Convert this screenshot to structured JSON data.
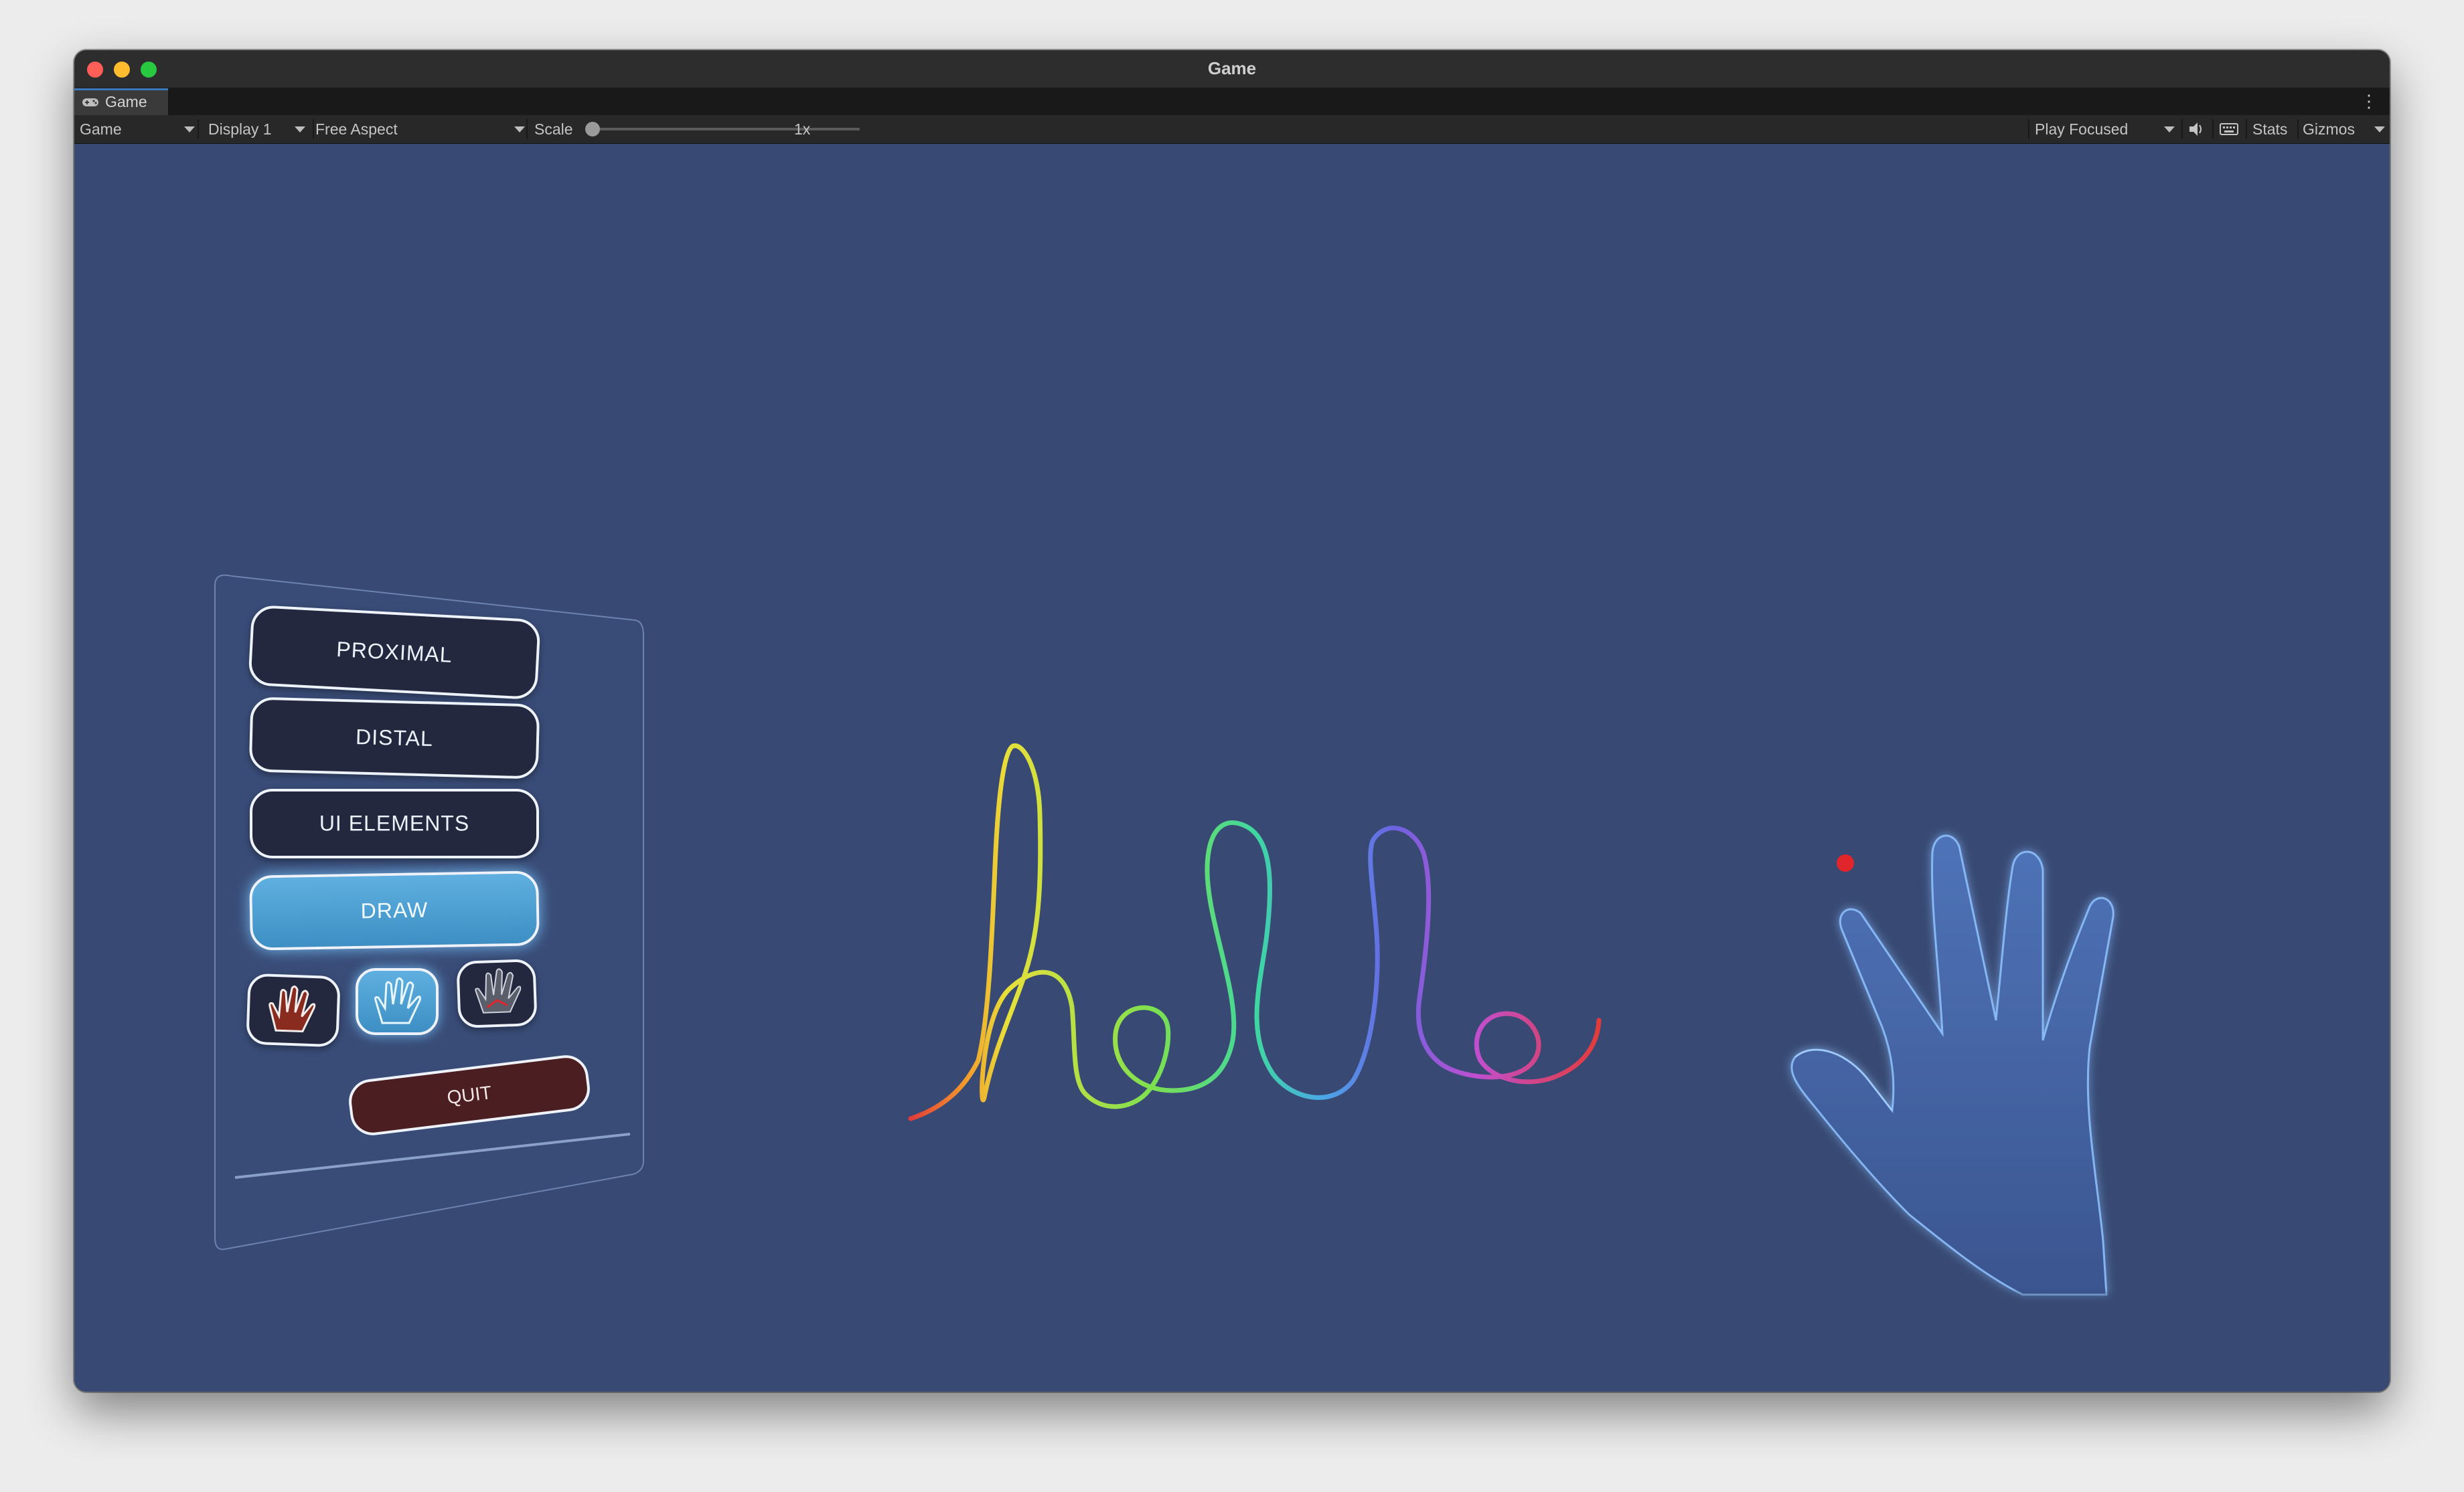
{
  "window": {
    "title": "Game"
  },
  "tab": {
    "label": "Game",
    "icon": "gamepad-icon"
  },
  "toolbar": {
    "view_mode": "Game",
    "display": "Display 1",
    "aspect": "Free Aspect",
    "scale_label": "Scale",
    "scale_value": "1x",
    "play_mode": "Play Focused",
    "stats_label": "Stats",
    "gizmos_label": "Gizmos"
  },
  "menu": {
    "buttons": [
      "PROXIMAL",
      "DISTAL",
      "UI ELEMENTS",
      "DRAW"
    ],
    "active": "DRAW",
    "hand_modes": [
      "hand-red-icon",
      "hand-outline-icon",
      "hand-dark-icon"
    ],
    "active_hand_mode": 1,
    "quit_label": "QUIT"
  },
  "scene": {
    "drawn_text": "hello",
    "stroke_colors": [
      "#e23b3b",
      "#f39a2a",
      "#e8e03a",
      "#7de04f",
      "#3fd7a0",
      "#4aa8e8",
      "#6a63e0",
      "#c04fd0",
      "#e23b6a"
    ],
    "pointer_color": "#e0262a"
  }
}
